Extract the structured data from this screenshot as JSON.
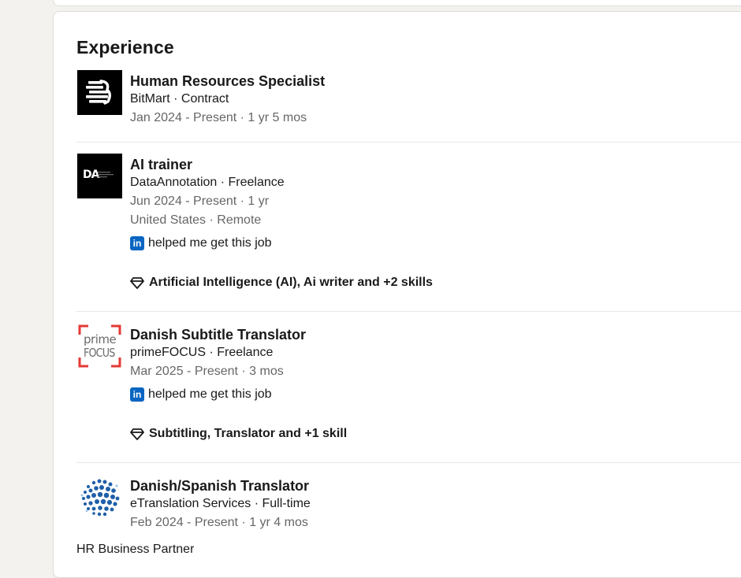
{
  "section": {
    "title": "Experience"
  },
  "entries": [
    {
      "title": "Human Resources Specialist",
      "company": "BitMart · Contract",
      "dates": "Jan 2024 - Present · 1 yr 5 mos"
    },
    {
      "title": "AI trainer",
      "company": "DataAnnotation · Freelance",
      "dates": "Jun 2024 - Present · 1 yr",
      "location": "United States · Remote",
      "helped": "helped me get this job",
      "skills": "Artificial Intelligence (AI), Ai writer and +2 skills",
      "logo_text": "DA"
    },
    {
      "title": "Danish Subtitle Translator",
      "company": "primeFOCUS · Freelance",
      "dates": "Mar 2025 - Present · 3 mos",
      "helped": "helped me get this job",
      "skills": "Subtitling, Translator and +1 skill",
      "logo_text_top": "prime",
      "logo_text_bottom": "FOCUS"
    },
    {
      "title": "Danish/Spanish Translator",
      "company": "eTranslation Services · Full-time",
      "dates": "Feb 2024 - Present · 1 yr 4 mos",
      "next_line": "HR Business Partner"
    }
  ],
  "icons": {
    "linkedin_glyph": "in",
    "linkedin_color": "#0a66c2"
  }
}
